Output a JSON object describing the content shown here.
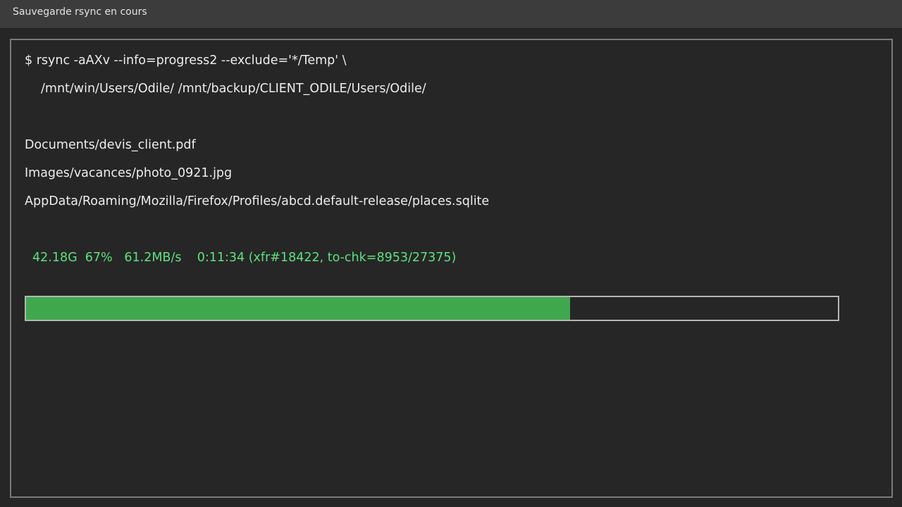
{
  "window": {
    "title": "Sauvegarde rsync en cours"
  },
  "terminal": {
    "command_line_1": "$ rsync -aAXv --info=progress2 --exclude='*/Temp' \\",
    "command_line_2": "/mnt/win/Users/Odile/ /mnt/backup/CLIENT_ODILE/Users/Odile/",
    "files": [
      "Documents/devis_client.pdf",
      "Images/vacances/photo_0921.jpg",
      "AppData/Roaming/Mozilla/Firefox/Profiles/abcd.default-release/places.sqlite"
    ],
    "progress_line": "42.18G  67%   61.2MB/s    0:11:34 (xfr#18422, to-chk=8953/27375)"
  },
  "progress": {
    "fraction": 0.67
  },
  "colors": {
    "background": "#262626",
    "titlebar": "#3c3c3c",
    "text": "#ececec",
    "progress_text": "#5fe07e",
    "progress_fill": "#3fa84f",
    "progress_border": "#b5b5b5"
  }
}
